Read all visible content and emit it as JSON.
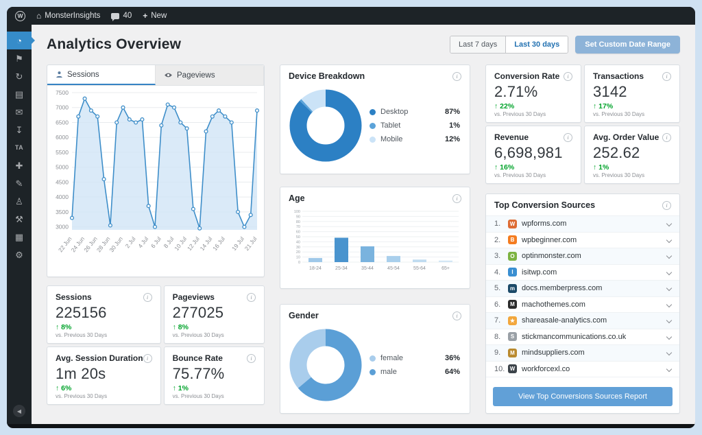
{
  "admin_bar": {
    "site_name": "MonsterInsights",
    "comments_count": "40",
    "new_label": "New"
  },
  "sidebar": {
    "items": [
      {
        "name": "monsterinsights",
        "icon": "gauge-icon",
        "glyph": "◔",
        "active": true
      },
      {
        "name": "pin",
        "icon": "pin-icon",
        "glyph": "⚑",
        "active": false
      },
      {
        "name": "updates",
        "icon": "update-icon",
        "glyph": "↻",
        "active": false
      },
      {
        "name": "pages",
        "icon": "pages-icon",
        "glyph": "▤",
        "active": false
      },
      {
        "name": "comments",
        "icon": "mail-icon",
        "glyph": "✉",
        "active": false
      },
      {
        "name": "downloads",
        "icon": "download-icon",
        "glyph": "↧",
        "active": false
      },
      {
        "name": "ta",
        "icon": "ta-label",
        "glyph": "TA",
        "active": false
      },
      {
        "name": "plugins",
        "icon": "plus-icon",
        "glyph": "✚",
        "active": false
      },
      {
        "name": "appearance",
        "icon": "pencil-icon",
        "glyph": "✎",
        "active": false
      },
      {
        "name": "users",
        "icon": "user-icon",
        "glyph": "♙",
        "active": false
      },
      {
        "name": "tools",
        "icon": "tools-icon",
        "glyph": "⚒",
        "active": false
      },
      {
        "name": "media",
        "icon": "grid-icon",
        "glyph": "▦",
        "active": false
      },
      {
        "name": "settings",
        "icon": "gear-icon",
        "glyph": "⚙",
        "active": false
      }
    ]
  },
  "header": {
    "title": "Analytics Overview",
    "range_buttons": [
      {
        "label": "Last 7 days",
        "active": false
      },
      {
        "label": "Last 30 days",
        "active": true
      }
    ],
    "custom_range_button": "Set Custom Date Range"
  },
  "sessions_panel": {
    "tabs": [
      {
        "label": "Sessions"
      },
      {
        "label": "Pageviews"
      }
    ],
    "chart": {
      "type": "line",
      "x_labels": [
        "22 Jun",
        "24 Jun",
        "26 Jun",
        "28 Jun",
        "30 Jun",
        "2 Jul",
        "4 Jul",
        "6 Jul",
        "8 Jul",
        "10 Jul",
        "12 Jul",
        "14 Jul",
        "16 Jul",
        "19 Jul",
        "21 Jul"
      ],
      "values": [
        3300,
        6700,
        7300,
        6900,
        6700,
        4600,
        3050,
        6500,
        7000,
        6600,
        6500,
        6600,
        3700,
        3000,
        6400,
        7100,
        7000,
        6500,
        6300,
        3600,
        2950,
        6200,
        6700,
        6900,
        6700,
        6500,
        3500,
        3000,
        3400,
        6900
      ],
      "yticks": [
        7500,
        7000,
        6500,
        6000,
        5500,
        5000,
        4500,
        4000,
        3500,
        3000
      ],
      "ylim": [
        2900,
        7500
      ],
      "line_color": "#3e8ec9",
      "area_color": "#cfe4f6",
      "point_fill": "#ffffff"
    }
  },
  "stat_cards": [
    {
      "slug": "sessions",
      "title": "Sessions",
      "value": "225156",
      "delta": "8%",
      "compare": "vs. Previous 30 Days"
    },
    {
      "slug": "pageviews",
      "title": "Pageviews",
      "value": "277025",
      "delta": "8%",
      "compare": "vs. Previous 30 Days"
    },
    {
      "slug": "avg-session-duration",
      "title": "Avg. Session Duration",
      "value": "1m 20s",
      "delta": "6%",
      "compare": "vs. Previous 30 Days"
    },
    {
      "slug": "bounce-rate",
      "title": "Bounce Rate",
      "value": "75.77%",
      "delta": "1%",
      "compare": "vs. Previous 30 Days"
    }
  ],
  "device_panel": {
    "title": "Device Breakdown",
    "chart": {
      "type": "pie",
      "labels": [
        "Desktop",
        "Tablet",
        "Mobile"
      ],
      "values": [
        87,
        1,
        12
      ],
      "colors": [
        "#2c80c4",
        "#5ba3d9",
        "#cbe3f7"
      ],
      "start_angle": 0
    }
  },
  "age_panel": {
    "title": "Age",
    "chart": {
      "type": "bar",
      "categories": [
        "18-24",
        "25-34",
        "35-44",
        "45-54",
        "55-64",
        "65+"
      ],
      "values": [
        8,
        48,
        31,
        12,
        5,
        3
      ],
      "colors": [
        "#9fc8e9",
        "#4a94ce",
        "#7ab3de",
        "#a9cfec",
        "#c0dbf0",
        "#d3e6f5"
      ],
      "ylim": [
        0,
        100
      ],
      "ytick_step": 10
    }
  },
  "gender_panel": {
    "title": "Gender",
    "chart": {
      "type": "pie",
      "labels": [
        "female",
        "male"
      ],
      "values": [
        36,
        64
      ],
      "colors": [
        "#a9cdec",
        "#5b9fd6"
      ],
      "start_angle": 230
    }
  },
  "metric_cards": [
    {
      "slug": "conversion-rate",
      "title": "Conversion Rate",
      "value": "2.71%",
      "delta": "22%",
      "compare": "vs. Previous 30 Days"
    },
    {
      "slug": "transactions",
      "title": "Transactions",
      "value": "3142",
      "delta": "17%",
      "compare": "vs. Previous 30 Days"
    },
    {
      "slug": "revenue",
      "title": "Revenue",
      "value": "6,698,981",
      "delta": "16%",
      "compare": "vs. Previous 30 Days"
    },
    {
      "slug": "avg-order-value",
      "title": "Avg. Order Value",
      "value": "252.62",
      "delta": "1%",
      "compare": "vs. Previous 30 Days"
    }
  ],
  "sources_panel": {
    "title": "Top Conversion Sources",
    "items": [
      {
        "rank": "1.",
        "domain": "wpforms.com",
        "favicon_color": "#dd6b33",
        "favicon_letter": "W"
      },
      {
        "rank": "2.",
        "domain": "wpbeginner.com",
        "favicon_color": "#f47c20",
        "favicon_letter": "B"
      },
      {
        "rank": "3.",
        "domain": "optinmonster.com",
        "favicon_color": "#7cb342",
        "favicon_letter": "O"
      },
      {
        "rank": "4.",
        "domain": "isitwp.com",
        "favicon_color": "#3a8fd1",
        "favicon_letter": "I"
      },
      {
        "rank": "5.",
        "domain": "docs.memberpress.com",
        "favicon_color": "#1c4a68",
        "favicon_letter": "m"
      },
      {
        "rank": "6.",
        "domain": "machothemes.com",
        "favicon_color": "#2b2b2b",
        "favicon_letter": "M"
      },
      {
        "rank": "7.",
        "domain": "shareasale-analytics.com",
        "favicon_color": "#f2a73d",
        "favicon_letter": "★"
      },
      {
        "rank": "8.",
        "domain": "stickmancommunications.co.uk",
        "favicon_color": "#9aa0a6",
        "favicon_letter": "S"
      },
      {
        "rank": "9.",
        "domain": "mindsuppliers.com",
        "favicon_color": "#b98a2f",
        "favicon_letter": "M"
      },
      {
        "rank": "10.",
        "domain": "workforcexl.co",
        "favicon_color": "#3c434a",
        "favicon_letter": "W"
      }
    ],
    "button_label": "View Top Conversions Sources Report"
  },
  "delta_icon": "↑"
}
